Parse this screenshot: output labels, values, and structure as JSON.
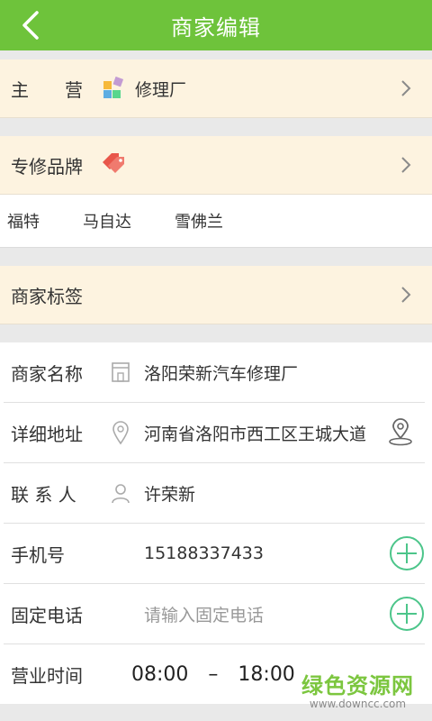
{
  "header": {
    "title": "商家编辑"
  },
  "main_business": {
    "label": "主　　营",
    "value": "修理厂"
  },
  "brands": {
    "label": "专修品牌",
    "items": [
      "福特",
      "马自达",
      "雪佛兰"
    ]
  },
  "tags": {
    "label": "商家标签"
  },
  "form": {
    "name": {
      "label": "商家名称",
      "value": "洛阳荣新汽车修理厂"
    },
    "address": {
      "label": "详细地址",
      "value": "河南省洛阳市西工区王城大道"
    },
    "contact": {
      "label": "联 系 人",
      "value": "许荣新"
    },
    "mobile": {
      "label": "手机号",
      "value": "15188337433"
    },
    "landline": {
      "label": "固定电话",
      "placeholder": "请输入固定电话"
    },
    "hours": {
      "label": "营业时间",
      "start": "08:00",
      "dash": "–",
      "end": "18:00"
    }
  },
  "watermark": {
    "line1": "绿色资源网",
    "line2": "www.downcc.com"
  },
  "colors": {
    "accent": "#6ec33b",
    "cream": "#fdf3e0",
    "plus": "#4cc58a"
  }
}
